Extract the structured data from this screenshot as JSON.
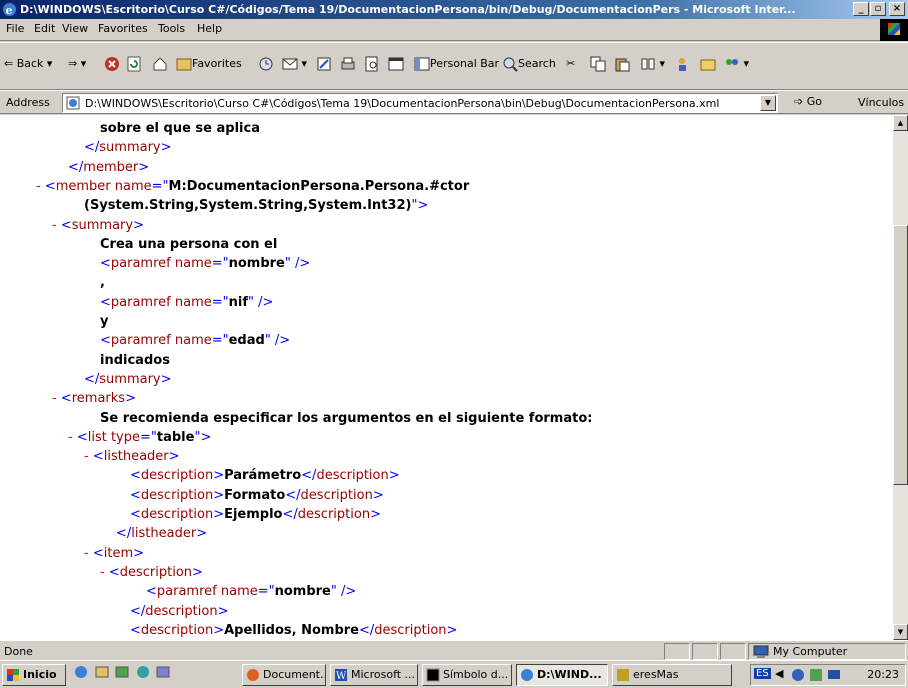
{
  "window": {
    "title": "D:\\WINDOWS\\Escritorio\\Curso C#/Códigos/Tema 19/DocumentacionPersona/bin/Debug/DocumentacionPers - Microsoft Inter...",
    "controls": [
      "_",
      "▫",
      "×"
    ]
  },
  "menu": [
    "File",
    "Edit",
    "View",
    "Favorites",
    "Tools",
    "Help"
  ],
  "toolbar": {
    "back": "Back",
    "favorites": "Favorites",
    "personal_bar": "Personal Bar",
    "search": "Search"
  },
  "address": {
    "label": "Address",
    "value": "D:\\WINDOWS\\Escritorio\\Curso C#\\Códigos\\Tema 19\\DocumentacionPersona\\bin\\Debug\\DocumentacionPersona.xml",
    "go": "Go",
    "links": "Vínculos"
  },
  "xml_lines": [
    {
      "minus": "",
      "parts": [
        {
          "t": "sobre el que se aplica",
          "c": "tx"
        }
      ]
    },
    {
      "minus": "",
      "parts": [
        {
          "t": "</",
          "c": "mk"
        },
        {
          "t": "summary",
          "c": "tag"
        },
        {
          "t": ">",
          "c": "mk"
        }
      ]
    },
    {
      "minus": "",
      "parts": [
        {
          "t": "</",
          "c": "mk"
        },
        {
          "t": "member",
          "c": "tag"
        },
        {
          "t": ">",
          "c": "mk"
        }
      ]
    },
    {
      "minus": "-",
      "parts": [
        {
          "t": "<",
          "c": "mk"
        },
        {
          "t": "member",
          "c": "tag"
        },
        {
          "t": " name",
          "c": "at"
        },
        {
          "t": "=\"",
          "c": "mk"
        },
        {
          "t": "M:DocumentacionPersona.Persona.#ctor",
          "c": "tx"
        }
      ]
    },
    {
      "minus": "",
      "parts": [
        {
          "t": "(System.String,System.String,System.Int32)",
          "c": "tx"
        },
        {
          "t": "\">",
          "c": "mk"
        }
      ]
    },
    {
      "minus": "-",
      "parts": [
        {
          "t": "<",
          "c": "mk"
        },
        {
          "t": "summary",
          "c": "tag"
        },
        {
          "t": ">",
          "c": "mk"
        }
      ]
    },
    {
      "minus": "",
      "parts": [
        {
          "t": "Crea una persona con el",
          "c": "tx"
        }
      ]
    },
    {
      "minus": "",
      "parts": [
        {
          "t": "<",
          "c": "mk"
        },
        {
          "t": "paramref",
          "c": "tag"
        },
        {
          "t": " name",
          "c": "at"
        },
        {
          "t": "=\"",
          "c": "mk"
        },
        {
          "t": "nombre",
          "c": "tx"
        },
        {
          "t": "\" />",
          "c": "mk"
        }
      ]
    },
    {
      "minus": "",
      "parts": [
        {
          "t": ",",
          "c": "tx"
        }
      ]
    },
    {
      "minus": "",
      "parts": [
        {
          "t": "<",
          "c": "mk"
        },
        {
          "t": "paramref",
          "c": "tag"
        },
        {
          "t": " name",
          "c": "at"
        },
        {
          "t": "=\"",
          "c": "mk"
        },
        {
          "t": "nif",
          "c": "tx"
        },
        {
          "t": "\" />",
          "c": "mk"
        }
      ]
    },
    {
      "minus": "",
      "parts": [
        {
          "t": "y",
          "c": "tx"
        }
      ]
    },
    {
      "minus": "",
      "parts": [
        {
          "t": "<",
          "c": "mk"
        },
        {
          "t": "paramref",
          "c": "tag"
        },
        {
          "t": " name",
          "c": "at"
        },
        {
          "t": "=\"",
          "c": "mk"
        },
        {
          "t": "edad",
          "c": "tx"
        },
        {
          "t": "\" />",
          "c": "mk"
        }
      ]
    },
    {
      "minus": "",
      "parts": [
        {
          "t": "indicados",
          "c": "tx"
        }
      ]
    },
    {
      "minus": "",
      "parts": [
        {
          "t": "</",
          "c": "mk"
        },
        {
          "t": "summary",
          "c": "tag"
        },
        {
          "t": ">",
          "c": "mk"
        }
      ]
    },
    {
      "minus": "-",
      "parts": [
        {
          "t": "<",
          "c": "mk"
        },
        {
          "t": "remarks",
          "c": "tag"
        },
        {
          "t": ">",
          "c": "mk"
        }
      ]
    },
    {
      "minus": "",
      "parts": [
        {
          "t": "Se recomienda especificar los argumentos en el siguiente formato:",
          "c": "tx"
        }
      ]
    },
    {
      "minus": "-",
      "parts": [
        {
          "t": "<",
          "c": "mk"
        },
        {
          "t": "list",
          "c": "tag"
        },
        {
          "t": " type",
          "c": "at"
        },
        {
          "t": "=\"",
          "c": "mk"
        },
        {
          "t": "table",
          "c": "tx"
        },
        {
          "t": "\">",
          "c": "mk"
        }
      ]
    },
    {
      "minus": "-",
      "parts": [
        {
          "t": "<",
          "c": "mk"
        },
        {
          "t": "listheader",
          "c": "tag"
        },
        {
          "t": ">",
          "c": "mk"
        }
      ]
    },
    {
      "minus": "",
      "parts": [
        {
          "t": "<",
          "c": "mk"
        },
        {
          "t": "description",
          "c": "tag"
        },
        {
          "t": ">",
          "c": "mk"
        },
        {
          "t": "Parámetro",
          "c": "tx"
        },
        {
          "t": "</",
          "c": "mk"
        },
        {
          "t": "description",
          "c": "tag"
        },
        {
          "t": ">",
          "c": "mk"
        }
      ]
    },
    {
      "minus": "",
      "parts": [
        {
          "t": "<",
          "c": "mk"
        },
        {
          "t": "description",
          "c": "tag"
        },
        {
          "t": ">",
          "c": "mk"
        },
        {
          "t": "Formato",
          "c": "tx"
        },
        {
          "t": "</",
          "c": "mk"
        },
        {
          "t": "description",
          "c": "tag"
        },
        {
          "t": ">",
          "c": "mk"
        }
      ]
    },
    {
      "minus": "",
      "parts": [
        {
          "t": "<",
          "c": "mk"
        },
        {
          "t": "description",
          "c": "tag"
        },
        {
          "t": ">",
          "c": "mk"
        },
        {
          "t": "Ejemplo",
          "c": "tx"
        },
        {
          "t": "</",
          "c": "mk"
        },
        {
          "t": "description",
          "c": "tag"
        },
        {
          "t": ">",
          "c": "mk"
        }
      ]
    },
    {
      "minus": "",
      "parts": [
        {
          "t": "</",
          "c": "mk"
        },
        {
          "t": "listheader",
          "c": "tag"
        },
        {
          "t": ">",
          "c": "mk"
        }
      ]
    },
    {
      "minus": "-",
      "parts": [
        {
          "t": "<",
          "c": "mk"
        },
        {
          "t": "item",
          "c": "tag"
        },
        {
          "t": ">",
          "c": "mk"
        }
      ]
    },
    {
      "minus": "-",
      "parts": [
        {
          "t": "<",
          "c": "mk"
        },
        {
          "t": "description",
          "c": "tag"
        },
        {
          "t": ">",
          "c": "mk"
        }
      ]
    },
    {
      "minus": "",
      "parts": [
        {
          "t": "<",
          "c": "mk"
        },
        {
          "t": "paramref",
          "c": "tag"
        },
        {
          "t": " name",
          "c": "at"
        },
        {
          "t": "=\"",
          "c": "mk"
        },
        {
          "t": "nombre",
          "c": "tx"
        },
        {
          "t": "\" />",
          "c": "mk"
        }
      ]
    },
    {
      "minus": "",
      "parts": [
        {
          "t": "</",
          "c": "mk"
        },
        {
          "t": "description",
          "c": "tag"
        },
        {
          "t": ">",
          "c": "mk"
        }
      ]
    },
    {
      "minus": "",
      "parts": [
        {
          "t": "<",
          "c": "mk"
        },
        {
          "t": "description",
          "c": "tag"
        },
        {
          "t": ">",
          "c": "mk"
        },
        {
          "t": "Apellidos, Nombre",
          "c": "tx"
        },
        {
          "t": "</",
          "c": "mk"
        },
        {
          "t": "description",
          "c": "tag"
        },
        {
          "t": ">",
          "c": "mk"
        }
      ]
    }
  ],
  "status": {
    "text": "Done",
    "zone": "My Computer"
  },
  "taskbar": {
    "start": "Inicio",
    "buttons": [
      "Document...",
      "Microsoft ...",
      "Símbolo d...",
      "D:\\WIND...",
      "eresMas"
    ],
    "lang": "ES",
    "clock": "20:23"
  }
}
